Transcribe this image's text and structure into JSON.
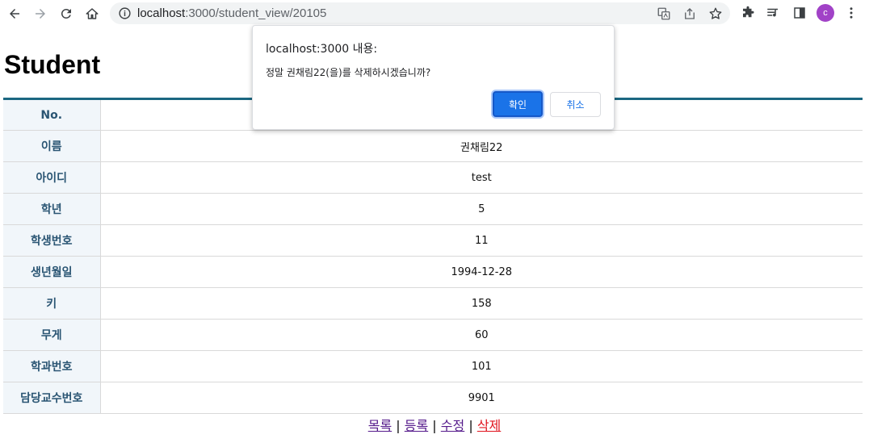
{
  "browser": {
    "url_host": "localhost",
    "url_path": ":3000/student_view/20105",
    "avatar_letter": "c",
    "icons": [
      "back-arrow-icon",
      "forward-arrow-icon",
      "reload-icon",
      "home-icon",
      "info-icon",
      "translate-icon",
      "share-icon",
      "star-icon",
      "extensions-icon",
      "media-icon",
      "sidepanel-icon",
      "menu-icon"
    ]
  },
  "page": {
    "title": "Student",
    "rows": [
      {
        "label": "No.",
        "value": ""
      },
      {
        "label": "이름",
        "value": "권채림22"
      },
      {
        "label": "아이디",
        "value": "test"
      },
      {
        "label": "학년",
        "value": "5"
      },
      {
        "label": "학생번호",
        "value": "11"
      },
      {
        "label": "생년월일",
        "value": "1994-12-28"
      },
      {
        "label": "키",
        "value": "158"
      },
      {
        "label": "무게",
        "value": "60"
      },
      {
        "label": "학과번호",
        "value": "101"
      },
      {
        "label": "담당교수번호",
        "value": "9901"
      }
    ],
    "links": {
      "list": "목록",
      "register": "등록",
      "edit": "수정",
      "delete": "삭제",
      "separator": "|"
    }
  },
  "dialog": {
    "title": "localhost:3000 내용:",
    "message": "정말 권채림22(을)를 삭제하시겠습니까?",
    "ok_label": "확인",
    "cancel_label": "취소"
  },
  "colors": {
    "table_border": "#1b6781",
    "header_bg": "#f1f6fa",
    "header_text": "#2a5573",
    "primary_button": "#1a73e8",
    "delete_link": "#e0141e"
  }
}
